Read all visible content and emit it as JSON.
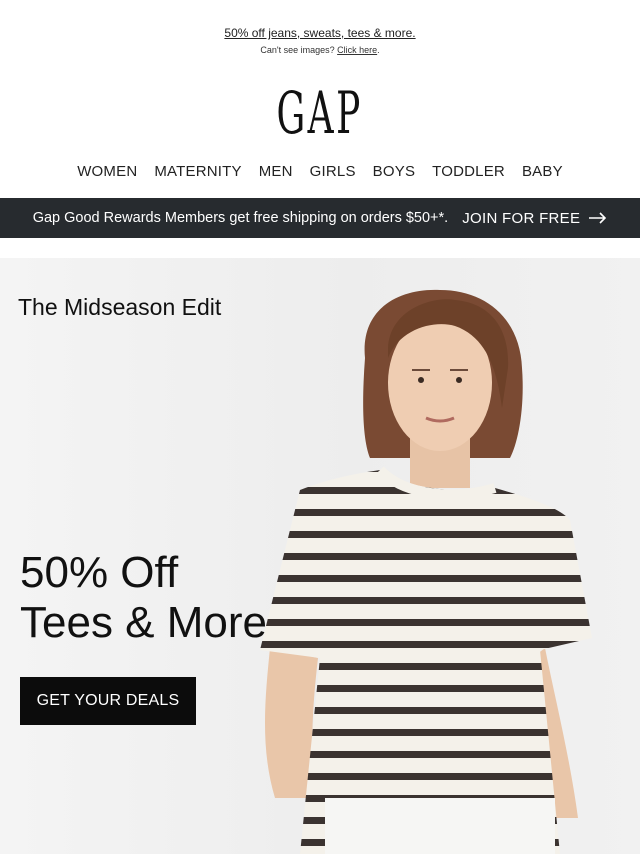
{
  "preheader": {
    "promo": "50% off jeans, sweats, tees & more.",
    "cant_see": "Can't see images?",
    "click_here": "Click here"
  },
  "brand": {
    "logo": "GAP"
  },
  "nav": [
    "WOMEN",
    "MATERNITY",
    "MEN",
    "GIRLS",
    "BOYS",
    "TODDLER",
    "BABY"
  ],
  "rewards": {
    "message": "Gap Good Rewards Members get free shipping on orders $50+*.",
    "join": "JOIN FOR FREE",
    "icon": "arrow-right-icon"
  },
  "hero": {
    "eyebrow": "The Midseason Edit",
    "headline_line1": "50% Off",
    "headline_line2": "Tees & More",
    "cta": "GET YOUR DEALS",
    "image": "woman-in-striped-tee"
  },
  "colors": {
    "banner_bg": "#272b2f",
    "cta_bg": "#0c0c0c",
    "hero_bg": "#efefef"
  }
}
